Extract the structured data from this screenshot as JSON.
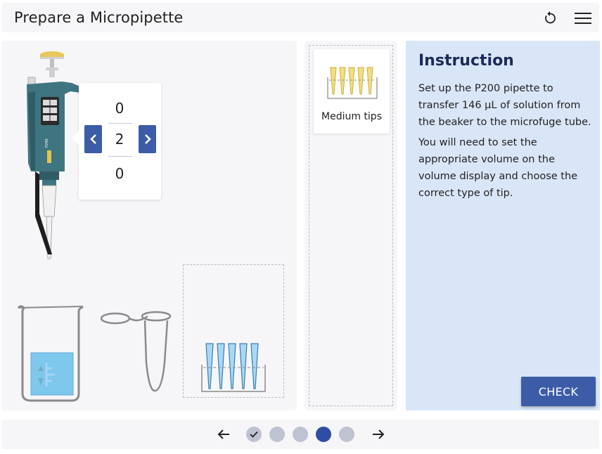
{
  "header": {
    "title": "Prepare a Micropipette",
    "reset_icon": "reset-icon",
    "menu_icon": "hamburger-menu-icon"
  },
  "pipette": {
    "model_label": "P200",
    "volume_digits": {
      "above": "0",
      "current": "2",
      "below": "0"
    }
  },
  "tips_panel": {
    "items": [
      {
        "label": "Medium tips",
        "color": "#f2df7f"
      }
    ]
  },
  "instruction": {
    "title": "Instruction",
    "paragraphs": [
      "Set up the P200 pipette to transfer 146 µL of solution from the beaker to the microfuge tube.",
      "You will need to set the appropriate volume on the volume display and choose the correct type of tip."
    ],
    "check_label": "CHECK"
  },
  "footer": {
    "steps": [
      {
        "status": "completed"
      },
      {
        "status": "pending"
      },
      {
        "status": "pending"
      },
      {
        "status": "current"
      },
      {
        "status": "pending"
      }
    ]
  },
  "colors": {
    "accent": "#3c5ca8",
    "instruction_bg": "#d9e6f7",
    "panel_bg": "#f6f6f9",
    "liquid": "#7ec8ee",
    "rack_tips": "#a8d8f4"
  }
}
